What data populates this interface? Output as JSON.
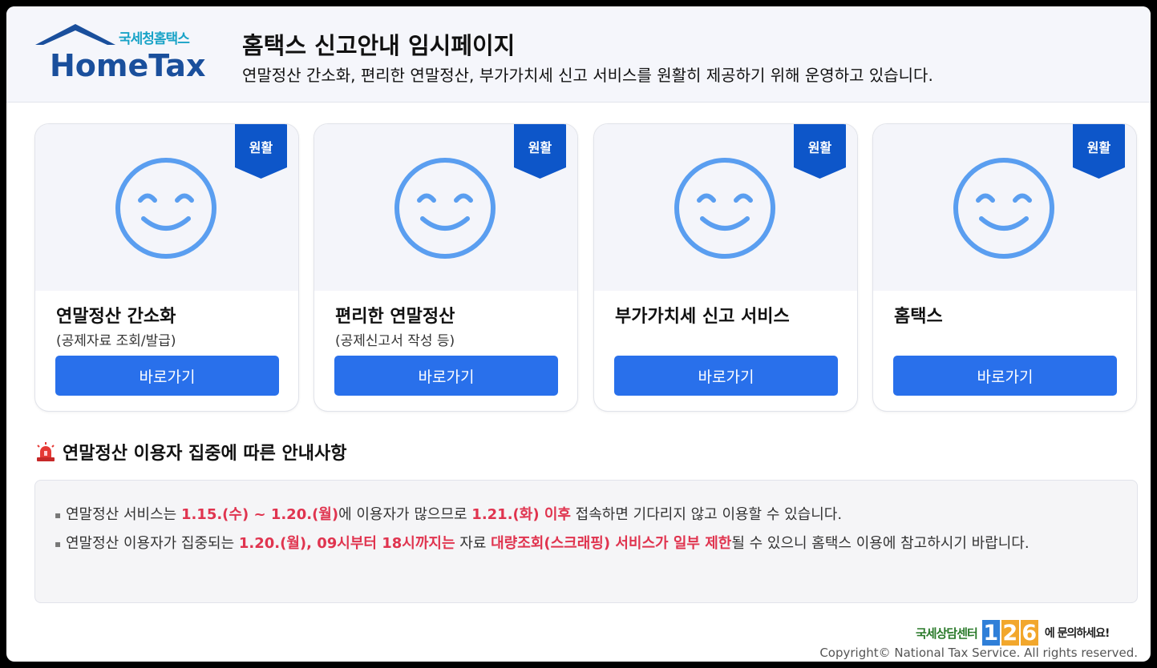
{
  "header": {
    "logo_korean": "국세청홈택스",
    "logo_english": "HomeTax",
    "title": "홈택스 신고안내 임시페이지",
    "subtitle": "연말정산 간소화, 편리한 연말정산, 부가가치세 신고 서비스를 원활히 제공하기 위해 운영하고 있습니다."
  },
  "cards": [
    {
      "badge": "원활",
      "title": "연말정산 간소화",
      "subtitle": "(공제자료 조회/발급)",
      "button": "바로가기"
    },
    {
      "badge": "원활",
      "title": "편리한 연말정산",
      "subtitle": "(공제신고서 작성 등)",
      "button": "바로가기"
    },
    {
      "badge": "원활",
      "title": "부가가치세 신고 서비스",
      "subtitle": "",
      "button": "바로가기"
    },
    {
      "badge": "원활",
      "title": "홈택스",
      "subtitle": "",
      "button": "바로가기"
    }
  ],
  "notice": {
    "heading": "연말정산 이용자 집중에 따른 안내사항",
    "item1": {
      "t1": "연말정산 서비스는 ",
      "r1": "1.15.(수) ~ 1.20.(월)",
      "t2": "에 이용자가 많으므로 ",
      "r2": "1.21.(화) 이후",
      "t3": " 접속하면 기다리지 않고 이용할 수 있습니다."
    },
    "item2": {
      "t1": "연말정산 이용자가 집중되는 ",
      "r1": "1.20.(월), 09시부터 18시까지는",
      "t2": " 자료 ",
      "r2": "대량조회(스크래핑) 서비스가 일부 제한",
      "t3": "될 수 있으니 홈택스 이용에 참고하시기 바랍니다."
    }
  },
  "footer": {
    "center_label": "국세상담센터",
    "phone_digits": [
      "1",
      "2",
      "6"
    ],
    "ask": "에 문의하세요!",
    "copyright": "Copyright© National Tax Service. All rights reserved."
  },
  "colors": {
    "accent": "#2970eb",
    "badge": "#0d56c9",
    "smiley": "#5a9ef0",
    "highlight": "#e0344f"
  }
}
